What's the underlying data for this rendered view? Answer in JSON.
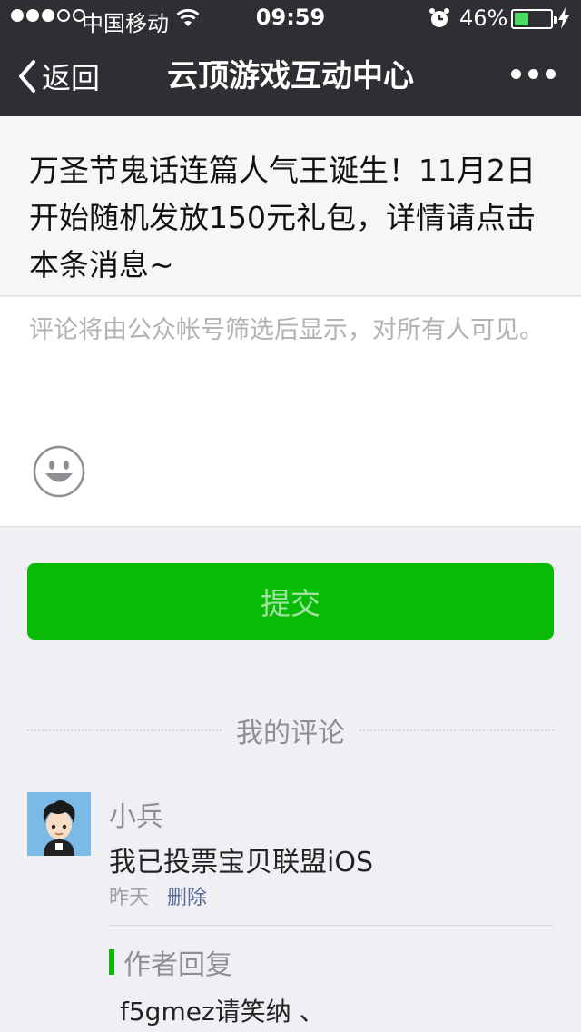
{
  "status_bar": {
    "carrier": "中国移动",
    "time": "09:59",
    "battery_percent": "46%",
    "battery_level": 0.46,
    "signal_strength": 3,
    "signal_max": 5
  },
  "nav": {
    "back_label": "返回",
    "title": "云顶游戏互动中心"
  },
  "article": {
    "title": "万圣节鬼话连篇人气王诞生！11月2日开始随机发放150元礼包，详情请点击本条消息~"
  },
  "comment_form": {
    "placeholder": "评论将由公众帐号筛选后显示，对所有人可见。",
    "submit_label": "提交"
  },
  "my_comments": {
    "heading": "我的评论",
    "items": [
      {
        "nickname": "小兵",
        "text": "我已投票宝贝联盟iOS",
        "date": "昨天",
        "delete_label": "删除",
        "reply": {
          "heading": "作者回复",
          "text": "f5gmez请笑纳 、"
        }
      }
    ]
  },
  "colors": {
    "nav_bg": "#2e2e33",
    "accent_green": "#09bb07",
    "link_blue": "#576b95",
    "battery_green": "#4cd964"
  }
}
